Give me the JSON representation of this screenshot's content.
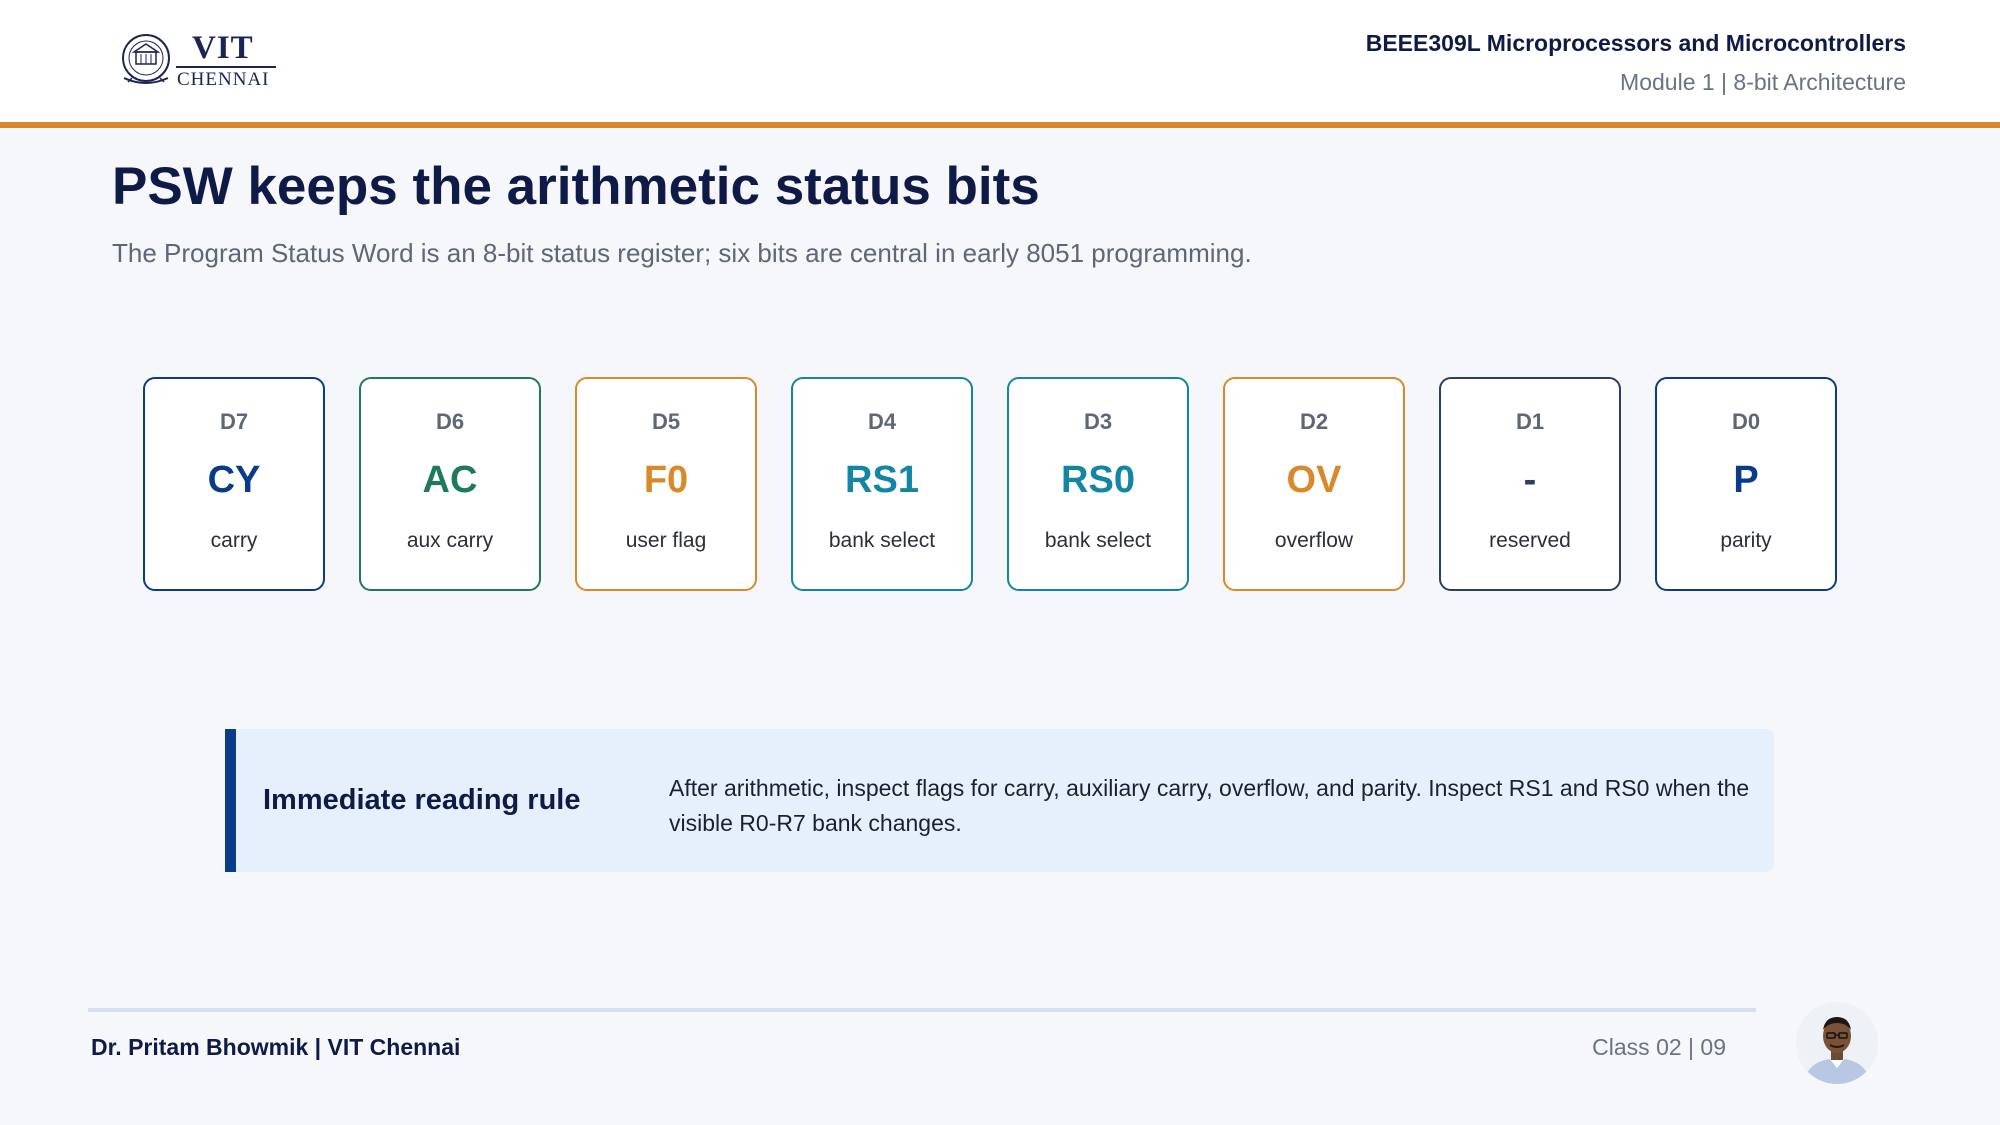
{
  "header": {
    "logo_main": "VIT",
    "logo_sub": "CHENNAI",
    "course": "BEEE309L Microprocessors and Microcontrollers",
    "module": "Module 1 | 8-bit Architecture"
  },
  "slide": {
    "title": "PSW keeps the arithmetic status bits",
    "subtitle": "The Program Status Word is an 8-bit status register; six bits are central in early 8051 programming."
  },
  "bits": [
    {
      "pos": "D7",
      "name": "CY",
      "desc": "carry",
      "color": "#0a3a8a"
    },
    {
      "pos": "D6",
      "name": "AC",
      "desc": "aux carry",
      "color": "#1f7a5a"
    },
    {
      "pos": "D5",
      "name": "F0",
      "desc": "user flag",
      "color": "#d9892a"
    },
    {
      "pos": "D4",
      "name": "RS1",
      "desc": "bank select",
      "color": "#1386a3"
    },
    {
      "pos": "D3",
      "name": "RS0",
      "desc": "bank select",
      "color": "#1386a3"
    },
    {
      "pos": "D2",
      "name": "OV",
      "desc": "overflow",
      "color": "#d9892a"
    },
    {
      "pos": "D1",
      "name": "-",
      "desc": "reserved",
      "color": "#2e3e5e"
    },
    {
      "pos": "D0",
      "name": "P",
      "desc": "parity",
      "color": "#0a3a8a"
    }
  ],
  "rule": {
    "title": "Immediate reading rule",
    "text": "After arithmetic, inspect flags for carry, auxiliary carry, overflow, and parity. Inspect RS1 and RS0 when the visible R0-R7 bank changes."
  },
  "footer": {
    "author": "Dr. Pritam Bhowmik | VIT Chennai",
    "class_info": "Class 02  |  09"
  },
  "colors": {
    "accent_orange": "#d9872a",
    "navy": "#0f1b46",
    "rule_bar": "#0a3a8a",
    "rule_bg": "#e6f0fd"
  },
  "icons": {
    "logo": "vit-seal-icon",
    "avatar": "presenter-photo"
  }
}
